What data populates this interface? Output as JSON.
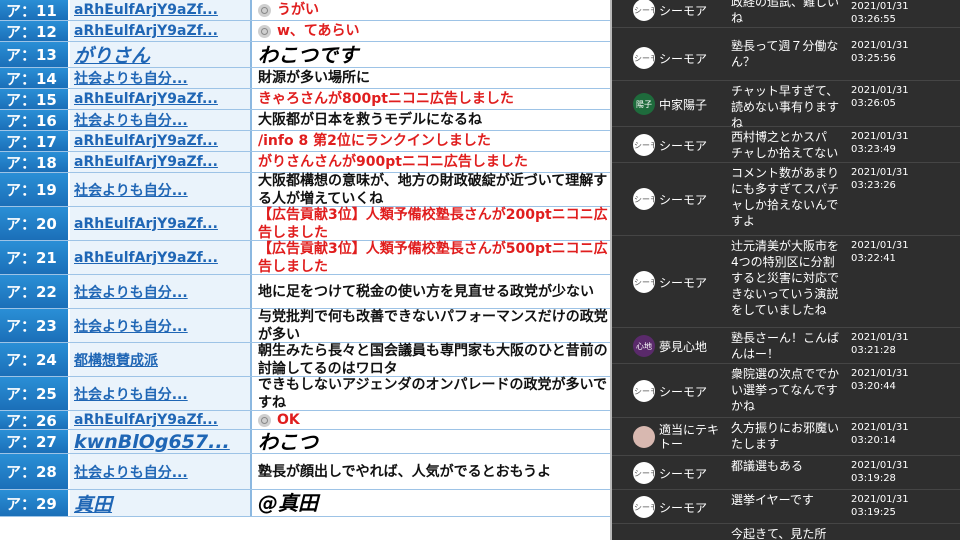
{
  "left_log": {
    "rows": [
      {
        "num": "ア：11",
        "name": "aRhEulfArjY9aZf...",
        "msg": "うがい",
        "red": true,
        "icon": true
      },
      {
        "num": "ア：12",
        "name": "aRhEulfArjY9aZf...",
        "msg": "w、てあらい",
        "red": true,
        "icon": true
      },
      {
        "num": "ア：13",
        "name": "がりさん",
        "msg": "わこつです",
        "big": true
      },
      {
        "num": "ア：14",
        "name": "社会よりも自分...",
        "msg": "財源が多い場所に"
      },
      {
        "num": "ア：15",
        "name": "aRhEulfArjY9aZf...",
        "msg": "きゃろさんが800ptニコニ広告しました",
        "red": true
      },
      {
        "num": "ア：16",
        "name": "社会よりも自分...",
        "msg": "大阪都が日本を救うモデルになるね"
      },
      {
        "num": "ア：17",
        "name": "aRhEulfArjY9aZf...",
        "msg": "/info 8 第2位にランクインしました",
        "red": true
      },
      {
        "num": "ア：18",
        "name": "aRhEulfArjY9aZf...",
        "msg": "がりさんさんが900ptニコニ広告しました",
        "red": true
      },
      {
        "num": "ア：19",
        "name": "社会よりも自分...",
        "msg": "大阪都構想の意味が、地方の財政破綻が近づいて理解する人が増えていくね"
      },
      {
        "num": "ア：20",
        "name": "aRhEulfArjY9aZf...",
        "msg": "【広告貢献3位】人類予備校塾長さんが200ptニコニ広告しました",
        "red": true
      },
      {
        "num": "ア：21",
        "name": "aRhEulfArjY9aZf...",
        "msg": "【広告貢献3位】人類予備校塾長さんが500ptニコニ広告しました",
        "red": true
      },
      {
        "num": "ア：22",
        "name": "社会よりも自分...",
        "msg": "地に足をつけて税金の使い方を見直せる政党が少ない"
      },
      {
        "num": "ア：23",
        "name": "社会よりも自分...",
        "msg": "与党批判で何も改善できないパフォーマンスだけの政党が多い"
      },
      {
        "num": "ア：24",
        "name": "都構想賛成派",
        "msg": "朝生みたら長々と国会議員も専門家も大阪のひと昔前の討論してるのはワロタ"
      },
      {
        "num": "ア：25",
        "name": "社会よりも自分...",
        "msg": "できもしないアジェンダのオンパレードの政党が多いですね"
      },
      {
        "num": "ア：26",
        "name": "aRhEulfArjY9aZf...",
        "msg": "OK",
        "red": true,
        "icon": true
      },
      {
        "num": "ア：27",
        "name": "kwnBlOg657...",
        "msg": "わこつ",
        "big": true
      },
      {
        "num": "ア：28",
        "name": "社会よりも自分...",
        "msg": "塾長が顔出しでやれば、人気がでるとおもうよ"
      },
      {
        "num": "ア：29",
        "name": "真田",
        "msg": "@真田",
        "big": true
      }
    ]
  },
  "chat": {
    "items": [
      {
        "user": "シーモア",
        "avatar": "シーモア",
        "text": "政経の追試、難しいね",
        "date": "2021/01/31",
        "time": "03:26:55"
      },
      {
        "user": "シーモア",
        "avatar": "シーモア",
        "text": "塾長って週７分働なん？",
        "date": "2021/01/31",
        "time": "03:25:56"
      },
      {
        "user": "中家陽子",
        "avatar": "陽子",
        "text": "チャット早すぎて、読めない事有りますね",
        "date": "2021/01/31",
        "time": "03:26:05"
      },
      {
        "user": "シーモア",
        "avatar": "シーモア",
        "text": "西村博之とかスパチャしか拾えてない",
        "date": "2021/01/31",
        "time": "03:23:49"
      },
      {
        "user": "シーモア",
        "avatar": "シーモア",
        "text": "コメント数があまりにも多すぎてスパチャしか拾えないんですよ",
        "date": "2021/01/31",
        "time": "03:23:26"
      },
      {
        "user": "シーモア",
        "avatar": "シーモア",
        "text": "辻元清美が大阪市を4つの特別区に分割すると災害に対応できないっていう演説をしていましたね",
        "date": "2021/01/31",
        "time": "03:22:41"
      },
      {
        "user": "夢見心地",
        "avatar": "心地",
        "text": "塾長さーん！こんばんはー！",
        "date": "2021/01/31",
        "time": "03:21:28"
      },
      {
        "user": "シーモア",
        "avatar": "シーモア",
        "text": "衆院選の次点ででかい選挙ってなんですかね",
        "date": "2021/01/31",
        "time": "03:20:44"
      },
      {
        "user": "適当にテキトー",
        "avatar": "",
        "text": "久方振りにお邪魔いたします",
        "date": "2021/01/31",
        "time": "03:20:14"
      },
      {
        "user": "シーモア",
        "avatar": "シーモア",
        "text": "都議選もある",
        "date": "2021/01/31",
        "time": "03:19:28"
      },
      {
        "user": "シーモア",
        "avatar": "シーモア",
        "text": "選挙イヤーです",
        "date": "2021/01/31",
        "time": "03:19:25"
      },
      {
        "user": "",
        "avatar": "",
        "text": "今起きて、見た所",
        "date": "",
        "time": ""
      }
    ]
  }
}
